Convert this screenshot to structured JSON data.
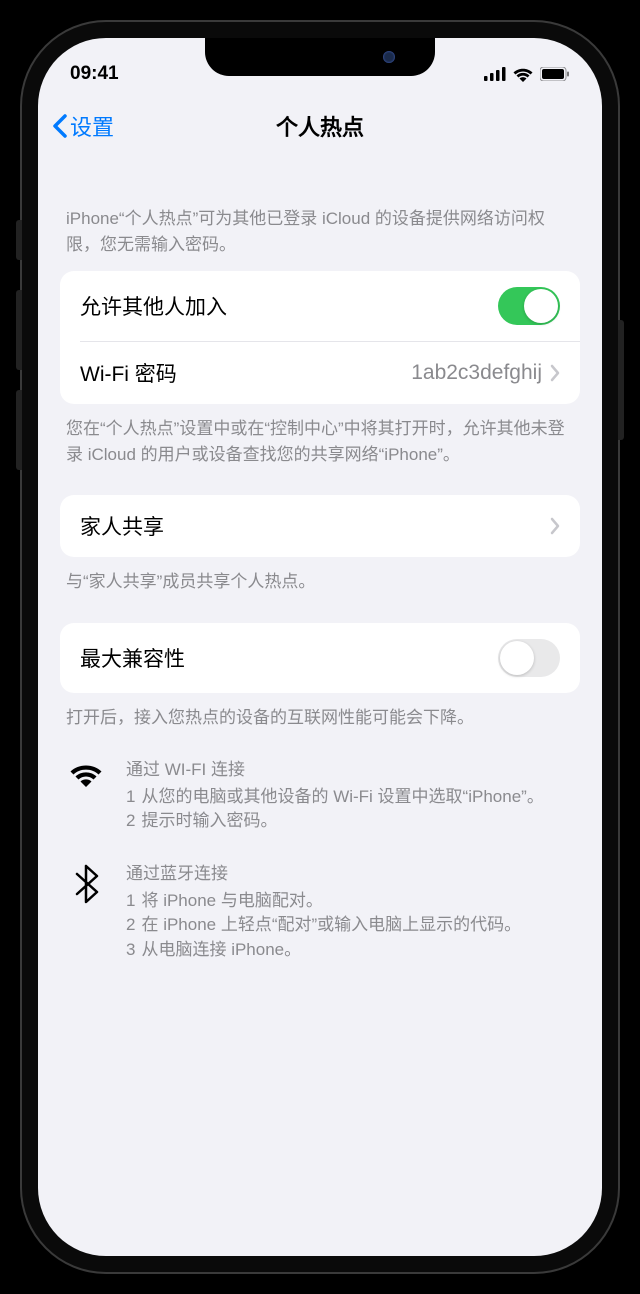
{
  "statusBar": {
    "time": "09:41"
  },
  "nav": {
    "back": "设置",
    "title": "个人热点"
  },
  "headerDesc": "iPhone“个人热点”可为其他已登录 iCloud 的设备提供网络访问权限，您无需输入密码。",
  "allowOthers": {
    "label": "允许其他人加入",
    "on": true
  },
  "wifiPassword": {
    "label": "Wi-Fi 密码",
    "value": "1ab2c3defghij"
  },
  "allowOthersFooter": "您在“个人热点”设置中或在“控制中心”中将其打开时，允许其他未登录 iCloud 的用户或设备查找您的共享网络“iPhone”。",
  "familySharing": {
    "label": "家人共享",
    "footer": "与“家人共享”成员共享个人热点。"
  },
  "maxCompat": {
    "label": "最大兼容性",
    "on": false,
    "footer": "打开后，接入您热点的设备的互联网性能可能会下降。"
  },
  "wifiInfo": {
    "title": "通过 WI-FI 连接",
    "steps": [
      "从您的电脑或其他设备的 Wi-Fi 设置中选取“iPhone”。",
      "提示时输入密码。"
    ]
  },
  "btInfo": {
    "title": "通过蓝牙连接",
    "steps": [
      "将 iPhone 与电脑配对。",
      "在 iPhone 上轻点“配对”或输入电脑上显示的代码。",
      "从电脑连接 iPhone。"
    ]
  }
}
